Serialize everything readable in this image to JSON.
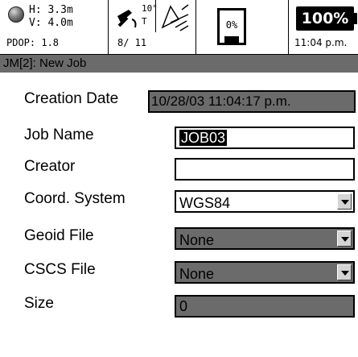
{
  "status": {
    "h": "H: 3.3m",
    "v": "V: 4.0m",
    "pdop": "PDOP: 1.8",
    "elev_mask": "10°",
    "sat_mode": "T",
    "sats": "8/ 11",
    "storage": "0%",
    "battery": "100%",
    "time": "11:04 p.m."
  },
  "title": "JM[2]: New Job",
  "form": {
    "creation_date": {
      "label": "Creation Date",
      "value": "10/28/03 11:04:17 p.m."
    },
    "job_name": {
      "label": "Job Name",
      "value": "JOB03"
    },
    "creator": {
      "label": "Creator",
      "value": ""
    },
    "coord_system": {
      "label": "Coord. System",
      "value": "WGS84"
    },
    "geoid_file": {
      "label": "Geoid File",
      "value": "None"
    },
    "cscs_file": {
      "label": "CSCS File",
      "value": "None"
    },
    "size": {
      "label": "Size",
      "value": "0"
    }
  },
  "icons": {
    "gps": "gps-globe-icon",
    "satellite": "satellite-dish-icon",
    "tilt": "tilt-sensor-icon",
    "disk": "storage-disk-icon",
    "battery": "battery-icon"
  },
  "colors": {
    "readonly_field": "#6b6b6b",
    "titlebar": "#6b6b6b",
    "selection": "#000000"
  }
}
